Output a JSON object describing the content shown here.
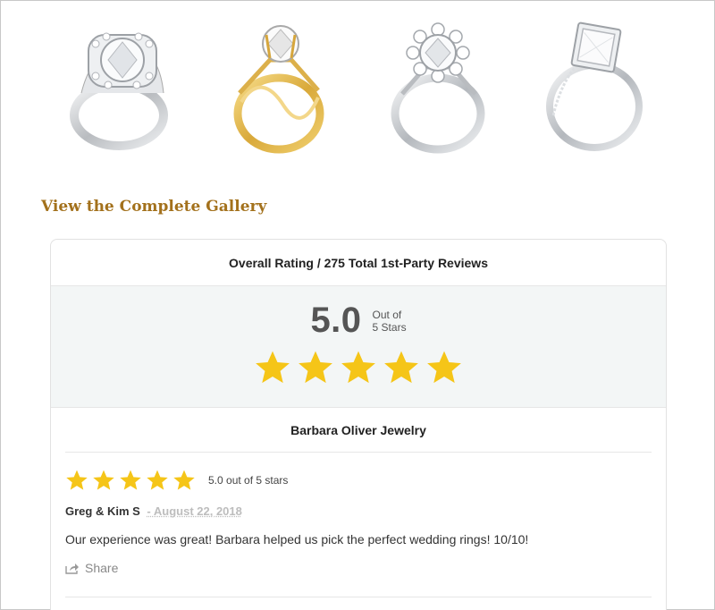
{
  "gallery": {
    "link_label": "View the Complete Gallery",
    "rings": [
      {
        "icon": "diamond-ring-halo-white-gold-icon",
        "metal": "#c9ccd0"
      },
      {
        "icon": "diamond-ring-twisted-yellow-gold-icon",
        "metal": "#e2b94a"
      },
      {
        "icon": "diamond-ring-flower-halo-white-gold-icon",
        "metal": "#c9ccd0"
      },
      {
        "icon": "diamond-ring-princess-white-gold-icon",
        "metal": "#c9ccd0"
      }
    ]
  },
  "reviews": {
    "header": "Overall Rating / 275 Total 1st-Party Reviews",
    "score": "5.0",
    "out_of_line1": "Out of",
    "out_of_line2": "5 Stars",
    "stars": 5,
    "star_color": "#f5c518",
    "business_name": "Barbara Oliver Jewelry",
    "items": [
      {
        "rating_text": "5.0 out of 5 stars",
        "stars": 5,
        "reviewer": "Greg & Kim S",
        "date": "- August 22, 2018",
        "text": "Our experience was great! Barbara helped us pick the perfect wedding rings! 10/10!",
        "share_label": "Share"
      }
    ]
  },
  "colors": {
    "accent": "#a3711c",
    "summary_bg": "#f3f6f6"
  }
}
